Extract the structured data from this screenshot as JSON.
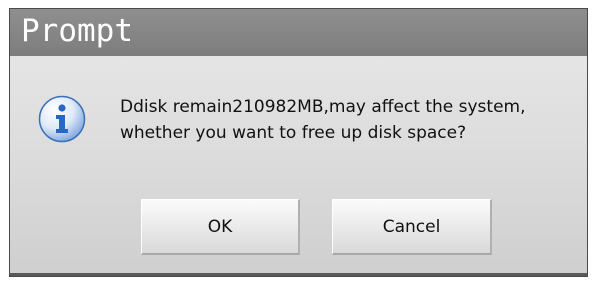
{
  "dialog": {
    "title": "Prompt",
    "icon": "info-icon",
    "message_lines": [
      "Ddisk remain210982MB,may affect the system,",
      "whether you want to free up disk space?"
    ],
    "buttons": {
      "ok_label": "OK",
      "cancel_label": "Cancel"
    }
  },
  "colors": {
    "titlebar": "#858585",
    "body": "#dcdcdc",
    "icon_blue": "#2a66c8"
  }
}
